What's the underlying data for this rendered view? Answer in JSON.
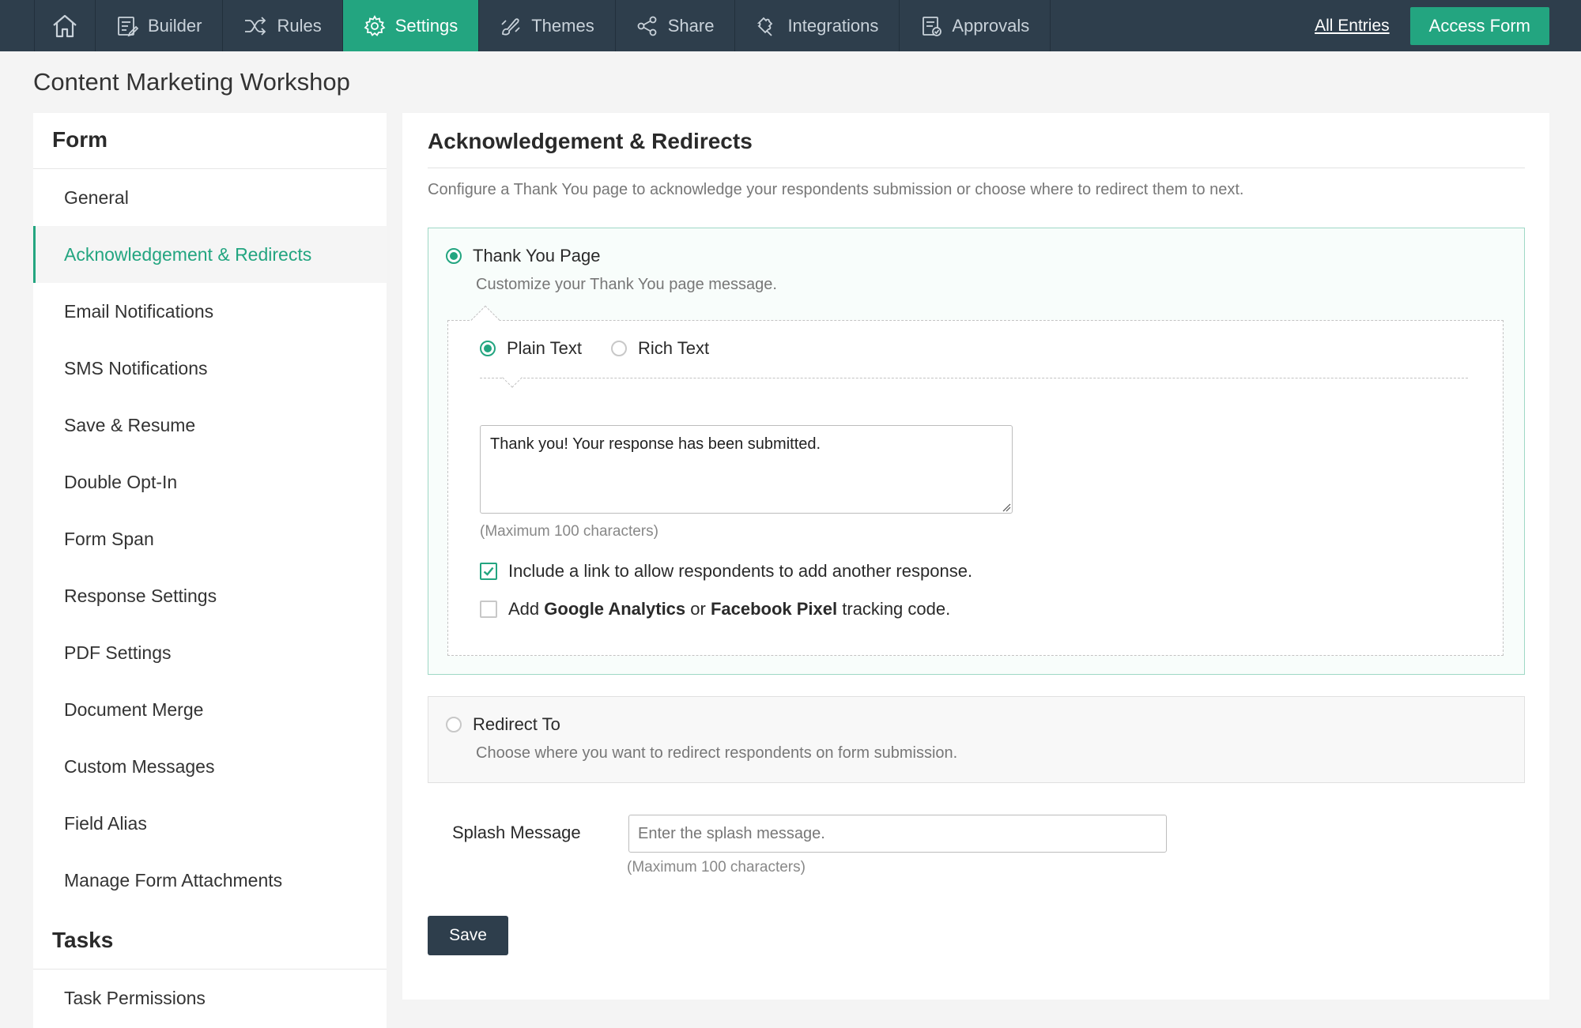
{
  "nav": {
    "items": [
      {
        "label": "Builder",
        "icon": "builder-icon"
      },
      {
        "label": "Rules",
        "icon": "shuffle-icon"
      },
      {
        "label": "Settings",
        "icon": "gear-icon"
      },
      {
        "label": "Themes",
        "icon": "brush-icon"
      },
      {
        "label": "Share",
        "icon": "share-icon"
      },
      {
        "label": "Integrations",
        "icon": "puzzle-icon"
      },
      {
        "label": "Approvals",
        "icon": "approvals-icon"
      }
    ],
    "active": "Settings",
    "all_entries": "All Entries",
    "access_form": "Access Form"
  },
  "page_title": "Content Marketing Workshop",
  "sidebar": {
    "form_heading": "Form",
    "items": [
      "General",
      "Acknowledgement & Redirects",
      "Email Notifications",
      "SMS Notifications",
      "Save & Resume",
      "Double Opt-In",
      "Form Span",
      "Response Settings",
      "PDF Settings",
      "Document Merge",
      "Custom Messages",
      "Field Alias",
      "Manage Form Attachments"
    ],
    "active_item": "Acknowledgement & Redirects",
    "tasks_heading": "Tasks",
    "task_items": [
      "Task Permissions"
    ]
  },
  "main": {
    "title": "Acknowledgement & Redirects",
    "description": "Configure a Thank You page to acknowledge your respondents submission or choose where to redirect them to next.",
    "thank_you": {
      "label": "Thank You Page",
      "sub": "Customize your Thank You page message.",
      "selected": true,
      "plain_text": "Plain Text",
      "rich_text": "Rich Text",
      "format": "Plain Text",
      "message": "Thank you! Your response has been submitted.",
      "max_hint": "(Maximum 100 characters)",
      "include_link": {
        "label": "Include a link to allow respondents to add another response.",
        "checked": true
      },
      "tracking": {
        "prefix": "Add ",
        "ga": "Google Analytics",
        "or": " or ",
        "fb": "Facebook Pixel",
        "suffix": " tracking code.",
        "checked": false
      }
    },
    "redirect": {
      "label": "Redirect To",
      "sub": "Choose where you want to redirect respondents on form submission.",
      "selected": false
    },
    "splash": {
      "label": "Splash Message",
      "placeholder": "Enter the splash message.",
      "value": "",
      "max_hint": "(Maximum 100 characters)"
    },
    "save_label": "Save"
  },
  "colors": {
    "nav_bg": "#2e3e4c",
    "accent": "#23a580",
    "save_bg": "#2e3e4c"
  }
}
